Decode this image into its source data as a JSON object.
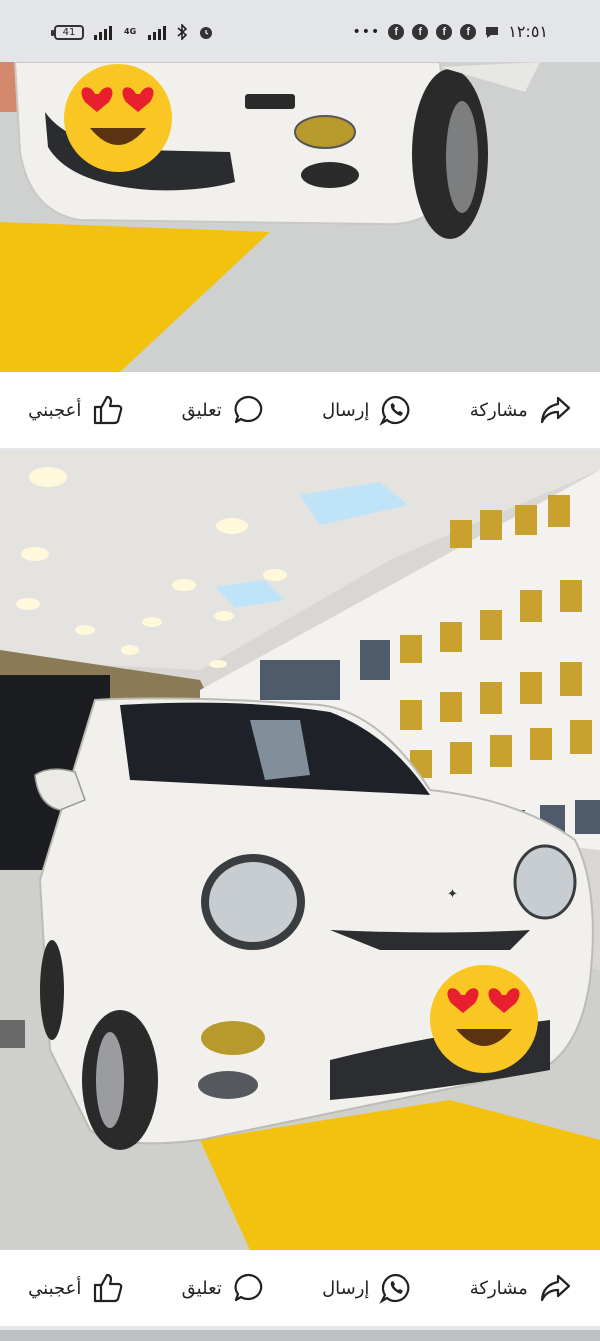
{
  "status_bar": {
    "battery": "41",
    "network": "4G",
    "time": "١٢:٥١",
    "overflow": "•••"
  },
  "posts": [
    {
      "actions": {
        "like": "أعجبني",
        "comment": "تعليق",
        "send": "إرسال",
        "share": "مشاركة"
      }
    },
    {
      "actions": {
        "like": "أعجبني",
        "comment": "تعليق",
        "send": "إرسال",
        "share": "مشاركة"
      }
    }
  ],
  "colors": {
    "floor_yellow": "#f2c20f",
    "car_white": "#f1f0ec",
    "icon_stroke": "#222222"
  }
}
